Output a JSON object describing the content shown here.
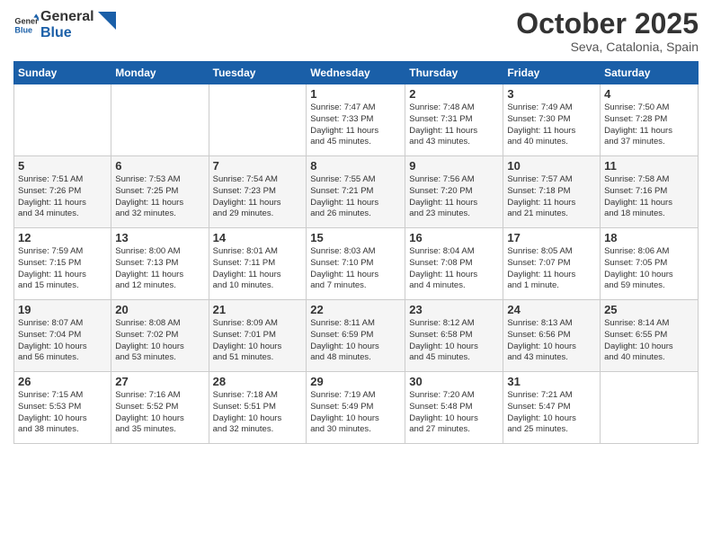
{
  "header": {
    "logo_line1": "General",
    "logo_line2": "Blue",
    "month": "October 2025",
    "location": "Seva, Catalonia, Spain"
  },
  "weekdays": [
    "Sunday",
    "Monday",
    "Tuesday",
    "Wednesday",
    "Thursday",
    "Friday",
    "Saturday"
  ],
  "weeks": [
    [
      {
        "num": "",
        "info": ""
      },
      {
        "num": "",
        "info": ""
      },
      {
        "num": "",
        "info": ""
      },
      {
        "num": "1",
        "info": "Sunrise: 7:47 AM\nSunset: 7:33 PM\nDaylight: 11 hours\nand 45 minutes."
      },
      {
        "num": "2",
        "info": "Sunrise: 7:48 AM\nSunset: 7:31 PM\nDaylight: 11 hours\nand 43 minutes."
      },
      {
        "num": "3",
        "info": "Sunrise: 7:49 AM\nSunset: 7:30 PM\nDaylight: 11 hours\nand 40 minutes."
      },
      {
        "num": "4",
        "info": "Sunrise: 7:50 AM\nSunset: 7:28 PM\nDaylight: 11 hours\nand 37 minutes."
      }
    ],
    [
      {
        "num": "5",
        "info": "Sunrise: 7:51 AM\nSunset: 7:26 PM\nDaylight: 11 hours\nand 34 minutes."
      },
      {
        "num": "6",
        "info": "Sunrise: 7:53 AM\nSunset: 7:25 PM\nDaylight: 11 hours\nand 32 minutes."
      },
      {
        "num": "7",
        "info": "Sunrise: 7:54 AM\nSunset: 7:23 PM\nDaylight: 11 hours\nand 29 minutes."
      },
      {
        "num": "8",
        "info": "Sunrise: 7:55 AM\nSunset: 7:21 PM\nDaylight: 11 hours\nand 26 minutes."
      },
      {
        "num": "9",
        "info": "Sunrise: 7:56 AM\nSunset: 7:20 PM\nDaylight: 11 hours\nand 23 minutes."
      },
      {
        "num": "10",
        "info": "Sunrise: 7:57 AM\nSunset: 7:18 PM\nDaylight: 11 hours\nand 21 minutes."
      },
      {
        "num": "11",
        "info": "Sunrise: 7:58 AM\nSunset: 7:16 PM\nDaylight: 11 hours\nand 18 minutes."
      }
    ],
    [
      {
        "num": "12",
        "info": "Sunrise: 7:59 AM\nSunset: 7:15 PM\nDaylight: 11 hours\nand 15 minutes."
      },
      {
        "num": "13",
        "info": "Sunrise: 8:00 AM\nSunset: 7:13 PM\nDaylight: 11 hours\nand 12 minutes."
      },
      {
        "num": "14",
        "info": "Sunrise: 8:01 AM\nSunset: 7:11 PM\nDaylight: 11 hours\nand 10 minutes."
      },
      {
        "num": "15",
        "info": "Sunrise: 8:03 AM\nSunset: 7:10 PM\nDaylight: 11 hours\nand 7 minutes."
      },
      {
        "num": "16",
        "info": "Sunrise: 8:04 AM\nSunset: 7:08 PM\nDaylight: 11 hours\nand 4 minutes."
      },
      {
        "num": "17",
        "info": "Sunrise: 8:05 AM\nSunset: 7:07 PM\nDaylight: 11 hours\nand 1 minute."
      },
      {
        "num": "18",
        "info": "Sunrise: 8:06 AM\nSunset: 7:05 PM\nDaylight: 10 hours\nand 59 minutes."
      }
    ],
    [
      {
        "num": "19",
        "info": "Sunrise: 8:07 AM\nSunset: 7:04 PM\nDaylight: 10 hours\nand 56 minutes."
      },
      {
        "num": "20",
        "info": "Sunrise: 8:08 AM\nSunset: 7:02 PM\nDaylight: 10 hours\nand 53 minutes."
      },
      {
        "num": "21",
        "info": "Sunrise: 8:09 AM\nSunset: 7:01 PM\nDaylight: 10 hours\nand 51 minutes."
      },
      {
        "num": "22",
        "info": "Sunrise: 8:11 AM\nSunset: 6:59 PM\nDaylight: 10 hours\nand 48 minutes."
      },
      {
        "num": "23",
        "info": "Sunrise: 8:12 AM\nSunset: 6:58 PM\nDaylight: 10 hours\nand 45 minutes."
      },
      {
        "num": "24",
        "info": "Sunrise: 8:13 AM\nSunset: 6:56 PM\nDaylight: 10 hours\nand 43 minutes."
      },
      {
        "num": "25",
        "info": "Sunrise: 8:14 AM\nSunset: 6:55 PM\nDaylight: 10 hours\nand 40 minutes."
      }
    ],
    [
      {
        "num": "26",
        "info": "Sunrise: 7:15 AM\nSunset: 5:53 PM\nDaylight: 10 hours\nand 38 minutes."
      },
      {
        "num": "27",
        "info": "Sunrise: 7:16 AM\nSunset: 5:52 PM\nDaylight: 10 hours\nand 35 minutes."
      },
      {
        "num": "28",
        "info": "Sunrise: 7:18 AM\nSunset: 5:51 PM\nDaylight: 10 hours\nand 32 minutes."
      },
      {
        "num": "29",
        "info": "Sunrise: 7:19 AM\nSunset: 5:49 PM\nDaylight: 10 hours\nand 30 minutes."
      },
      {
        "num": "30",
        "info": "Sunrise: 7:20 AM\nSunset: 5:48 PM\nDaylight: 10 hours\nand 27 minutes."
      },
      {
        "num": "31",
        "info": "Sunrise: 7:21 AM\nSunset: 5:47 PM\nDaylight: 10 hours\nand 25 minutes."
      },
      {
        "num": "",
        "info": ""
      }
    ]
  ]
}
